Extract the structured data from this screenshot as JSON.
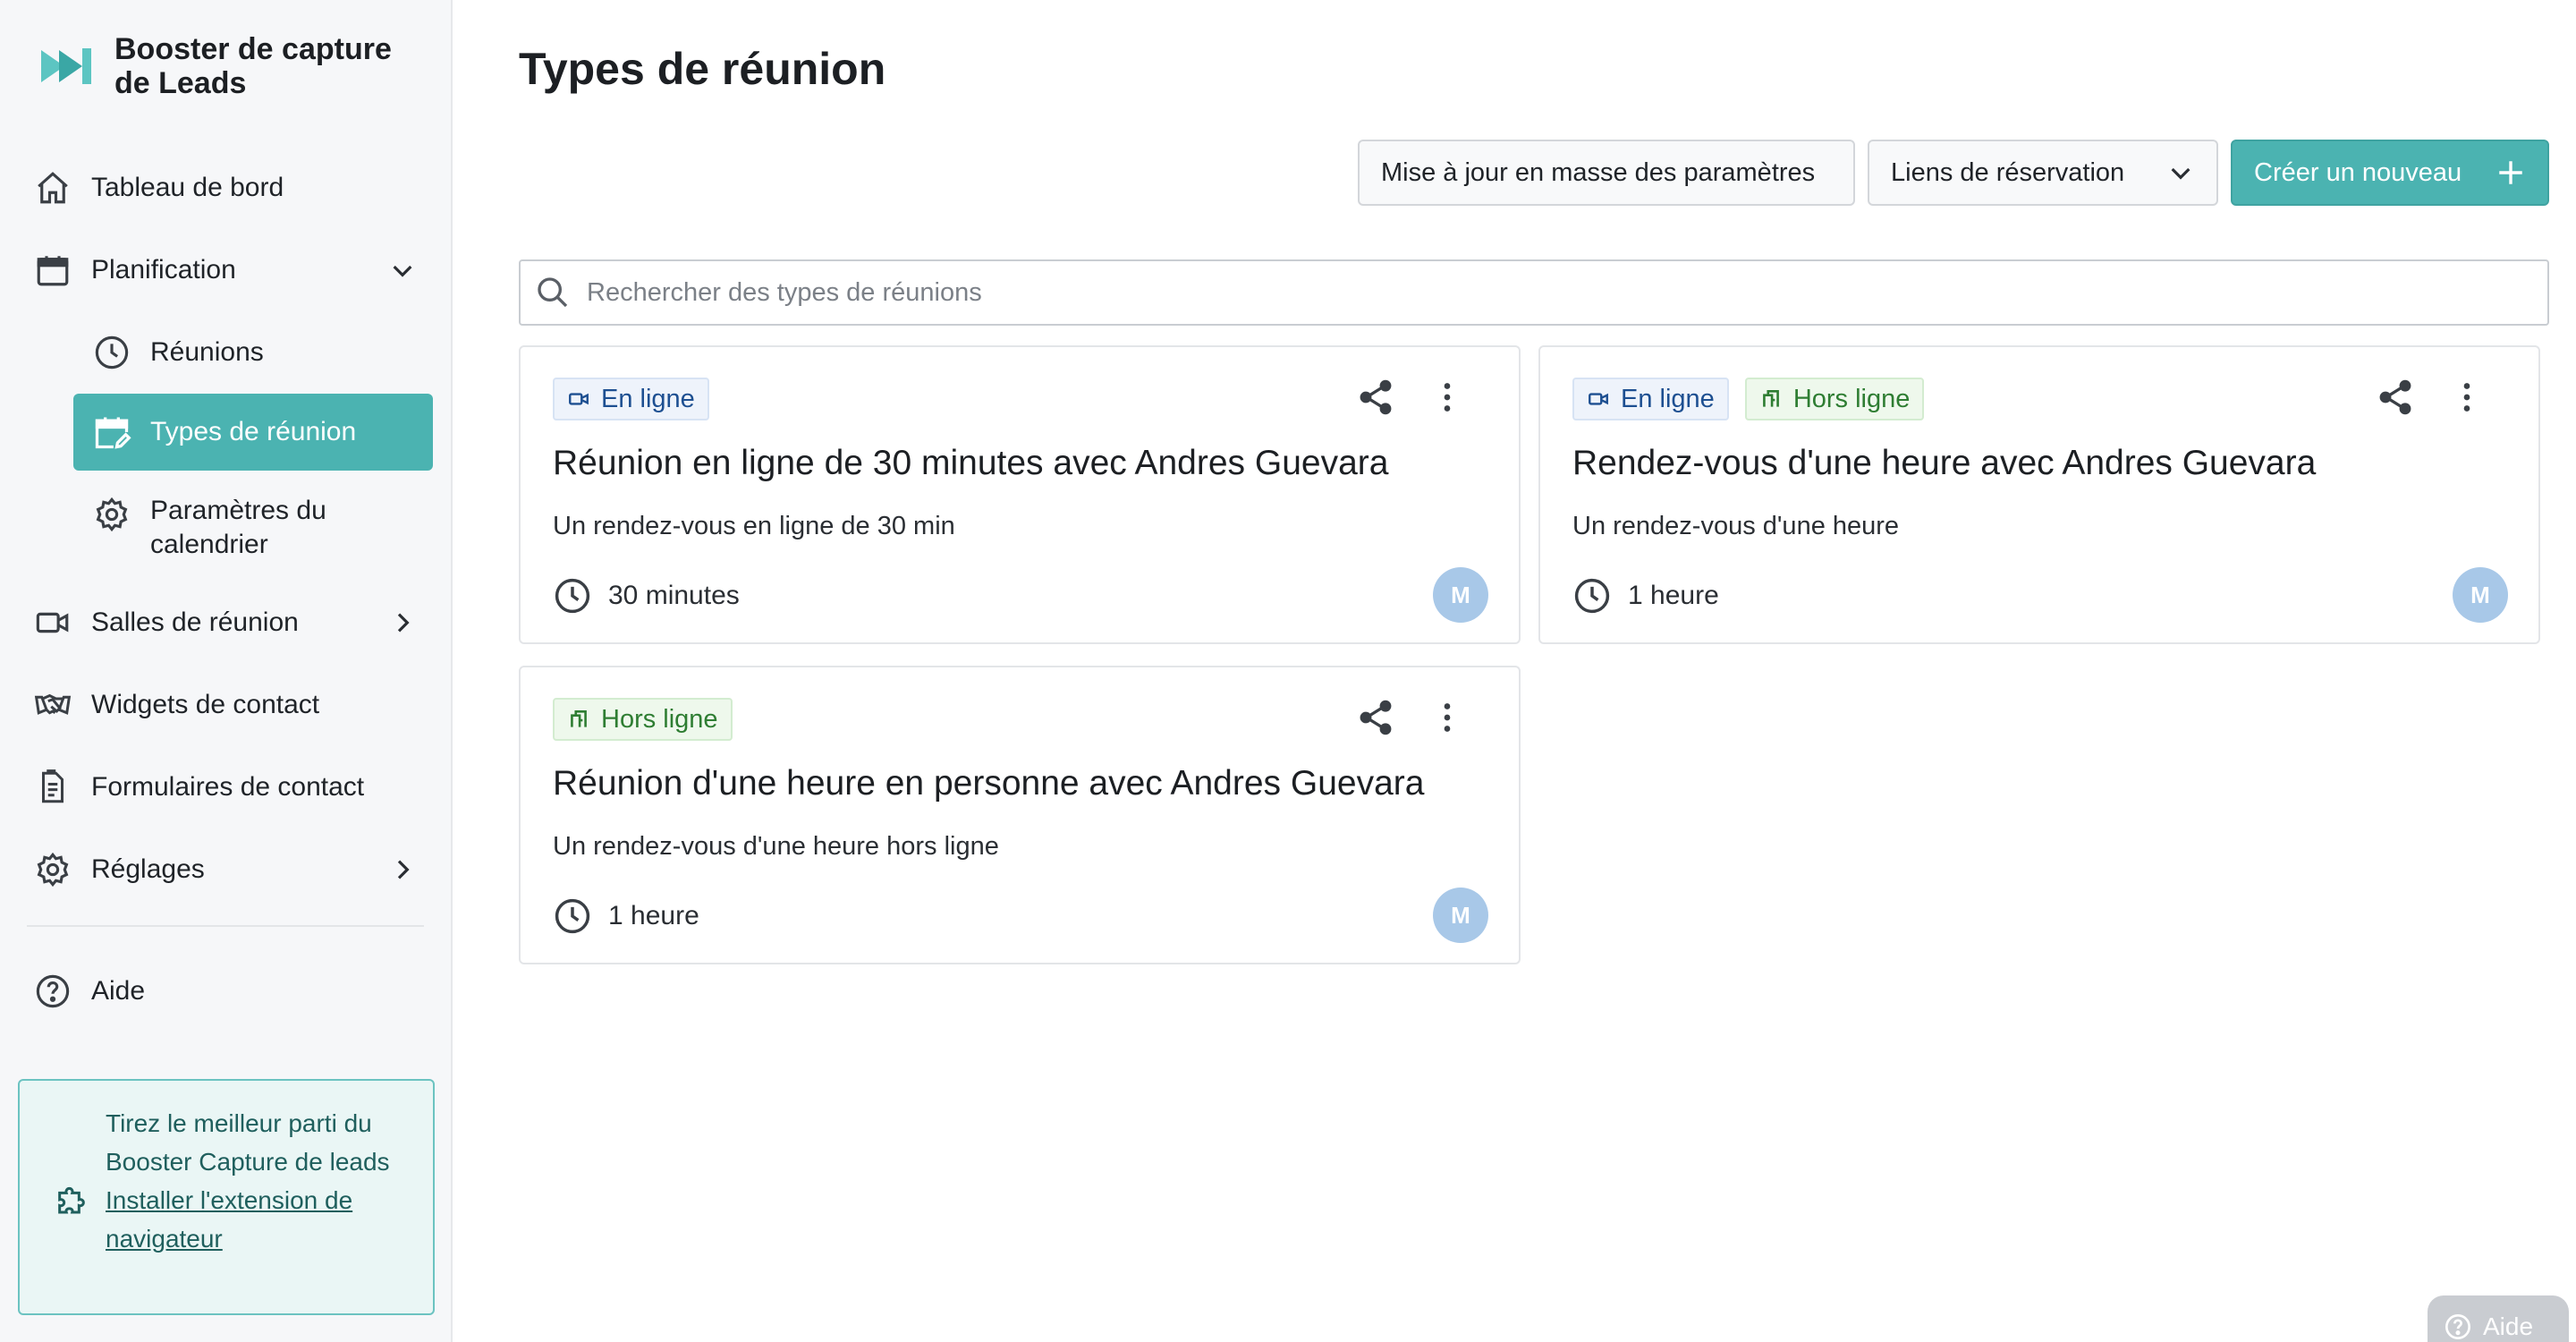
{
  "brand": {
    "name": "Booster de capture de Leads",
    "logo_icon": "booster-logo",
    "accent": "#4bb3b1"
  },
  "sidebar": {
    "items": [
      {
        "label": "Tableau de bord",
        "icon": "home-icon"
      },
      {
        "label": "Planification",
        "icon": "calendar-icon",
        "expanded": true
      },
      {
        "label": "Réunions",
        "icon": "clock-icon"
      },
      {
        "label": "Types de réunion",
        "icon": "calendar-edit-icon",
        "active": true
      },
      {
        "label": "Paramètres du calendrier",
        "icon": "gear-icon"
      },
      {
        "label": "Salles de réunion",
        "icon": "video-icon"
      },
      {
        "label": "Widgets de contact",
        "icon": "handshake-icon"
      },
      {
        "label": "Formulaires de contact",
        "icon": "form-icon"
      },
      {
        "label": "Réglages",
        "icon": "gear-icon"
      },
      {
        "label": "Aide",
        "icon": "help-icon"
      }
    ],
    "promo": {
      "text": "Tirez le meilleur parti du Booster Capture de leads",
      "link": "Installer l'extension de navigateur",
      "icon": "puzzle-icon"
    }
  },
  "main": {
    "title": "Types de réunion",
    "toolbar": {
      "bulk_label": "Mise à jour en masse des paramètres",
      "links_label": "Liens de réservation",
      "create_label": "Créer un nouveau"
    },
    "search": {
      "placeholder": "Rechercher des types de réunions",
      "value": ""
    },
    "cards": [
      {
        "tags": [
          "En ligne"
        ],
        "title": "Réunion en ligne de 30 minutes avec Andres Guevara",
        "description": "Un rendez-vous en ligne de 30 min",
        "duration": "30 minutes",
        "avatar": "M"
      },
      {
        "tags": [
          "En ligne",
          "Hors ligne"
        ],
        "title": "Rendez-vous d'une heure avec Andres Guevara",
        "description": "Un rendez-vous d'une heure",
        "duration": "1 heure",
        "avatar": "M"
      },
      {
        "tags": [
          "Hors ligne"
        ],
        "title": "Réunion d'une heure en personne avec Andres Guevara",
        "description": "Un rendez-vous d'une heure hors ligne",
        "duration": "1 heure",
        "avatar": "M"
      }
    ]
  },
  "help_fab": {
    "label": "Aide"
  }
}
